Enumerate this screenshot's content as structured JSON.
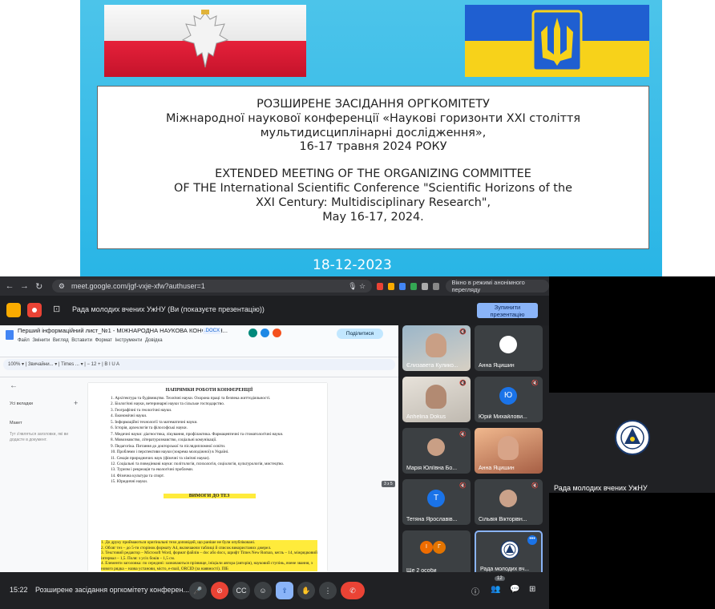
{
  "slide": {
    "title_uk_1": "РОЗШИРЕНЕ ЗАСІДАННЯ ОРГКОМІТЕТУ",
    "title_uk_2": "Міжнародної наукової конференції «Наукові горизонти ХХІ століття",
    "title_uk_3": "мультидисциплінарні дослідження»,",
    "title_uk_4": "16-17 травня 2024 РОКУ",
    "title_en_1": "EXTENDED MEETING OF THE ORGANIZING COMMITTEE",
    "title_en_2": "OF THE International Scientific Conference \"Scientific Horizons of the",
    "title_en_3": "XXI Century: Multidisciplinary Research\",",
    "title_en_4": "May 16-17, 2024.",
    "date": "18-12-2023"
  },
  "browser": {
    "url": "meet.google.com/jgf-vxje-xfw?authuser=1",
    "incognito": "Вікно в режимі анонімного перегляду"
  },
  "present_bar": {
    "text": "Рада молодих вчених УжНУ (Ви (показуєте презентацію))",
    "stop_label": "Зупинити презентацію"
  },
  "docs": {
    "title": "Перший інформаційний лист_№1 - МІЖНАРОДНА НАУКОВА КОНФЕРЕН...",
    "badge": ".DOCX",
    "menu": "Файл Змінити Вигляд Вставити Формат Інструменти Довідка",
    "share": "Поділитися",
    "toolbar": "100% ▾ | Звичайни... ▾ | Times ... ▾ | − 12 + | B I U A",
    "outline_tabs": "Усі вкладки",
    "outline_head": "Макет",
    "outline_hint": "Тут з'являться заголовки, які ви додасте в документ.",
    "page_indicator": "3 з 5",
    "heading": "НАПРЯМКИ РОБОТИ КОНФЕРЕНЦІЇ",
    "items": [
      "1. Архітектура та будівництво. Технічні науки. Охорона праці та безпека життєдіяльності.",
      "2. Біологічні науки, ветеринарні науки та сільське господарство.",
      "3. Географічні та геологічні науки.",
      "4. Економічні науки.",
      "5. Інформаційні технології та математичні науки.",
      "6. Історія, археологія та філософські науки.",
      "7. Медичні науки: діагностика, лікування, профілактика. Фармацевтичні та стоматологічні науки.",
      "8. Мовознавство, літературознавство, соціальні комунікації.",
      "9. Педагогіка. Питання до докторської та післядипломної освіти.",
      "10. Проблеми і перспективи науки (зокрема молодіжної) в Україні.",
      "11. Секція природничих наук (фізичні та хімічні науки).",
      "12. Соціальні та поведінкові науки: політологія, психологія, соціологія, культурологія, мистецтво.",
      "13. Туризм і рекреація та екологічні проблеми.",
      "14. Фізична культура та спорт.",
      "15. Юридичні науки."
    ],
    "req_heading": "ВИМОГИ ДО ТЕЗ",
    "req_items": [
      "1. До друку приймаються оригінальні тези доповідей, що раніше не були опубліковані.",
      "2. Обсяг тез – до 5-ти сторінок формату А4, включаючи таблиці й список використаних джерел.",
      "3. Текстовий редактор – Microsoft Word, формат файлів – doc або docx, шрифт Times New Roman, кегль – 14, міжрядковий інтервал – 1,5. Поля: з усіх боків – 1,5 см.",
      "4. Елементи заголовка: по середині: зазначаються прізвище, ініціали автора (авторів), науковий ступінь, вчене звання, з нового рядка – назва установи, місто, e-mail, ORCID (за наявності). ПІБ"
    ]
  },
  "participants": [
    {
      "name": "Єлизавета Кулико..."
    },
    {
      "name": "Анна Яцишин"
    },
    {
      "name": "Anhelina Dokus"
    },
    {
      "name": "Юрій Михайлови...",
      "initial": "Ю"
    },
    {
      "name": "Марія Юліївна Бо..."
    },
    {
      "name": "Анна Яцишин"
    },
    {
      "name": "Тетяна Ярославів...",
      "initial": "Т"
    },
    {
      "name": "Сільвія Вікторівн..."
    },
    {
      "name": "Ще 2 особи",
      "initials": [
        "І",
        "Г"
      ]
    },
    {
      "name": "Рада молодих вч..."
    }
  ],
  "right_tile": {
    "name": "Рада молодих вчених УжНУ"
  },
  "bottom": {
    "time": "15:22",
    "meeting_title": "Розширене засідання оргкомітету конферен...",
    "participant_count": "12"
  },
  "colors": {
    "slide_bg": "#29b5e6",
    "present_stop": "#8ab4f8",
    "end_call": "#ea4335"
  }
}
